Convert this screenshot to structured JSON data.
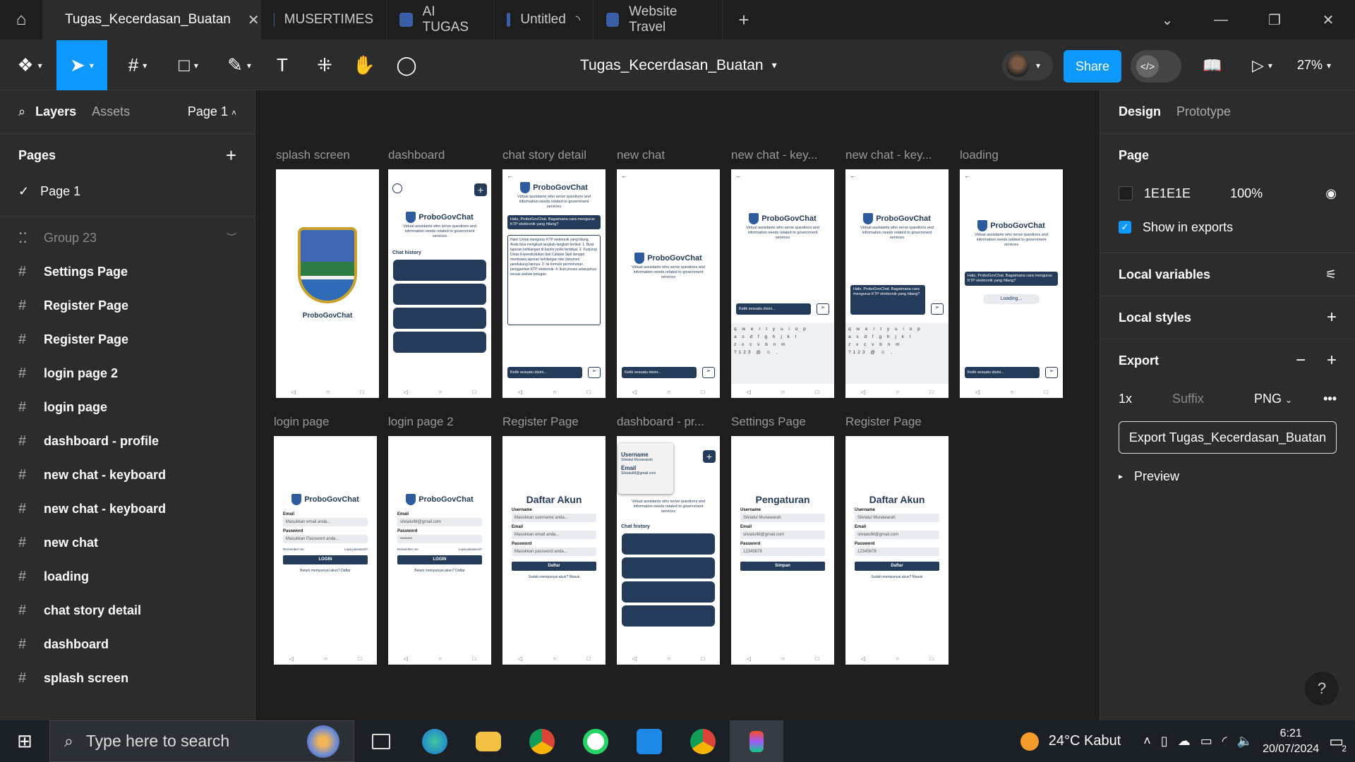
{
  "tabs": [
    {
      "label": "Tugas_Kecerdasan_Buatan",
      "active": true
    },
    {
      "label": "MUSERTIMES"
    },
    {
      "label": "AI TUGAS"
    },
    {
      "label": "Untitled"
    },
    {
      "label": "Website Travel"
    }
  ],
  "toolbar": {
    "doc_title": "Tugas_Kecerdasan_Buatan",
    "share": "Share",
    "zoom": "27%"
  },
  "left": {
    "tabs": {
      "layers": "Layers",
      "assets": "Assets",
      "page": "Page 1"
    },
    "pages_title": "Pages",
    "pages": [
      "Page 1"
    ],
    "group": "Group 23",
    "layers": [
      "Settings Page",
      "Register Page",
      "Register Page",
      "login page 2",
      "login page",
      "dashboard - profile",
      "new chat - keyboard",
      "new chat - keyboard",
      "new chat",
      "loading",
      "chat story detail",
      "dashboard",
      "splash screen"
    ]
  },
  "canvas": {
    "row1": [
      "splash screen",
      "dashboard",
      "chat story detail",
      "new chat",
      "new chat - key...",
      "new chat - key...",
      "loading"
    ],
    "row2": [
      "login page",
      "login page 2",
      "Register Page",
      "dashboard - pr...",
      "Settings Page",
      "Register Page"
    ],
    "app_name": "ProboGovChat",
    "tagline": "Virtual assistants who serve questions and information needs related to government services",
    "chat_history": "Chat history",
    "chat_placeholder": "Ketik sesuatu disini...",
    "question": "Halo, ProboGovChat. Bagaimana cara mengurus KTP elektronik yang hilang?",
    "answer": "Halo! Untuk mengurus KTP elektronik yang hilang, Anda bisa mengikuti langkah-langkah berikut: 1. Buat laporan kehilangan di kantor polisi terdekat. 2. Kunjungi Dinas Kependudukan dan Catatan Sipil dengan membawa laporan kehilangan dan dokumen pendukung lainnya. 3. Isi formulir permohonan penggantian KTP elektronik. 4. Ikuti proses selanjutnya sesuai arahan petugas.",
    "loading": "Loading...",
    "kb_row1": "q w e r t y u i o p",
    "kb_row2": "a s d f g h j k l",
    "kb_row3": "z x c v b n m",
    "kb_row4": "?123 @ ☺ ,",
    "login": {
      "email_label": "Email",
      "email_ph": "Masukkan email anda...",
      "password_label": "Password",
      "password_ph": "Masukkan Password anda...",
      "remember": "Remember me",
      "forgot": "Lupa password?",
      "button": "LOGIN",
      "register": "Belum mempunyai akun? Daftar"
    },
    "login2": {
      "email": "silviatulM@gmail.com",
      "password": "••••••••"
    },
    "register": {
      "title": "Daftar Akun",
      "username_label": "Username",
      "username_ph": "Masukkan username anda...",
      "email_label": "Email",
      "email_ph": "Masukkan email anda...",
      "password_label": "Password",
      "password_ph": "Masukkan password anda...",
      "button": "Daftar",
      "login": "Sudah mempunyai akun? Masuk"
    },
    "settings": {
      "title": "Pengaturan",
      "username": "Silviatul Munawarah",
      "email": "silviatulM@gmail.com",
      "password": "12345678",
      "button": "Simpan"
    },
    "register2": {
      "username": "Silviatul Munawarah",
      "email": "silviatulM@gmail.com",
      "password": "12345678"
    },
    "profile": {
      "username_label": "Username",
      "username": "Silviatul Munawarah",
      "email_label": "Email",
      "email": "SilviatulM@gmail.com"
    }
  },
  "right": {
    "tabs": {
      "design": "Design",
      "prototype": "Prototype"
    },
    "page_title": "Page",
    "bg_hex": "1E1E1E",
    "bg_opacity": "100%",
    "show_exports": "Show in exports",
    "local_variables": "Local variables",
    "local_styles": "Local styles",
    "export_title": "Export",
    "export_scale": "1x",
    "export_suffix": "Suffix",
    "export_format": "PNG",
    "export_button": "Export Tugas_Kecerdasan_Buatan",
    "preview": "Preview"
  },
  "taskbar": {
    "search_placeholder": "Type here to search",
    "weather": "24°C Kabut",
    "time": "6:21",
    "date": "20/07/2024",
    "notif_count": "2"
  }
}
